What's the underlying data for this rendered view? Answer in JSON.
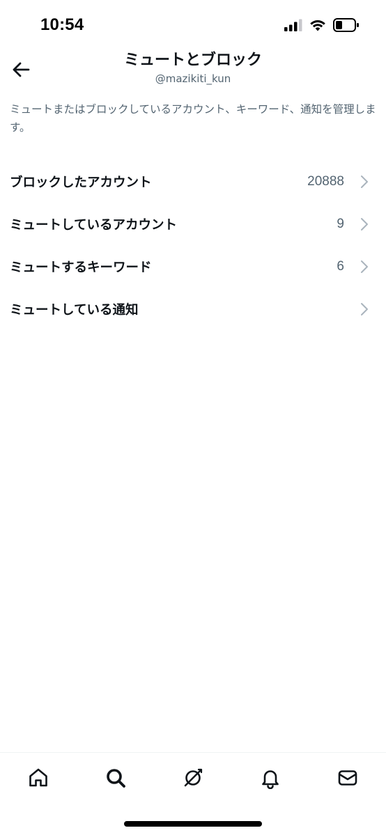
{
  "status_bar": {
    "time": "10:54",
    "icons": [
      "signal-icon",
      "wifi-icon",
      "battery-icon"
    ]
  },
  "header": {
    "title": "ミュートとブロック",
    "handle": "@mazikiti_kun",
    "back_icon": "arrow-left-icon"
  },
  "description": "ミュートまたはブロックしているアカウント、キーワード、通知を管理します。",
  "items": [
    {
      "label": "ブロックしたアカウント",
      "count": "20888"
    },
    {
      "label": "ミュートしているアカウント",
      "count": "9"
    },
    {
      "label": "ミュートするキーワード",
      "count": "6"
    },
    {
      "label": "ミュートしている通知",
      "count": ""
    }
  ],
  "bottom_nav": [
    "home-icon",
    "search-icon",
    "spaces-icon",
    "notifications-icon",
    "messages-icon"
  ],
  "colors": {
    "text_primary": "#0f1419",
    "text_secondary": "#536471",
    "chevron": "#aab4bd",
    "background": "#ffffff"
  }
}
